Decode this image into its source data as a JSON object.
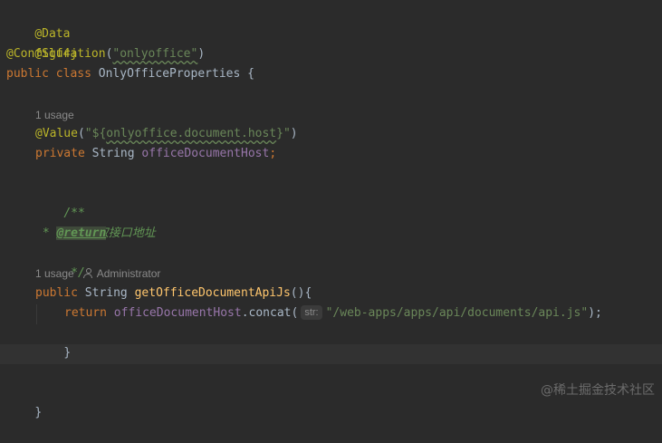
{
  "editor": {
    "lines": {
      "l1": {
        "annotation": "@Data"
      },
      "l2": {
        "annotation": "@Slf4j"
      },
      "l3": {
        "annotation": "@Configuration",
        "open": "(",
        "string": "\"onlyoffice\"",
        "close": ")"
      },
      "l4": {
        "kw_public": "public",
        "kw_class": "class",
        "class_name": "OnlyOfficeProperties",
        "brace": "{"
      },
      "l6": {
        "annotation": "@Value",
        "open": "(",
        "str_prefix": "\"${",
        "str_key": "onlyoffice.document.host",
        "str_suffix": "}\"",
        "close": ")"
      },
      "l7": {
        "kw_private": "private",
        "type": "String",
        "field": "officeDocumentHost",
        "semi": ";"
      },
      "l9": {
        "text": "/**"
      },
      "l10": {
        "text": " * 获取接口地址"
      },
      "l11": {
        "prefix": " * ",
        "tag": "@return"
      },
      "l12": {
        "text": " */"
      },
      "l13": {
        "kw_public": "public",
        "type": "String",
        "method": "getOfficeDocumentApiJs",
        "parens": "()",
        "brace": "{"
      },
      "l14": {
        "kw_return": "return",
        "field": "officeDocumentHost",
        "dot_concat": ".concat(",
        "param_hint": "str:",
        "string": "\"/web-apps/apps/api/documents/api.js\"",
        "close": ");"
      },
      "l15": {
        "brace": "}"
      },
      "l17": {
        "brace": "}"
      }
    },
    "hints": {
      "usage1": "1 usage",
      "usage2": "1 usage",
      "author": "Administrator"
    }
  },
  "watermark": "@稀土掘金技术社区",
  "colors": {
    "background": "#2b2b2b",
    "annotation": "#bbb529",
    "keyword": "#cc7832",
    "string": "#6a8759",
    "field": "#9876aa",
    "method": "#ffc66d",
    "doc_comment": "#629755",
    "text": "#a9b7c6",
    "inlay_hint": "#8a8a8a"
  }
}
